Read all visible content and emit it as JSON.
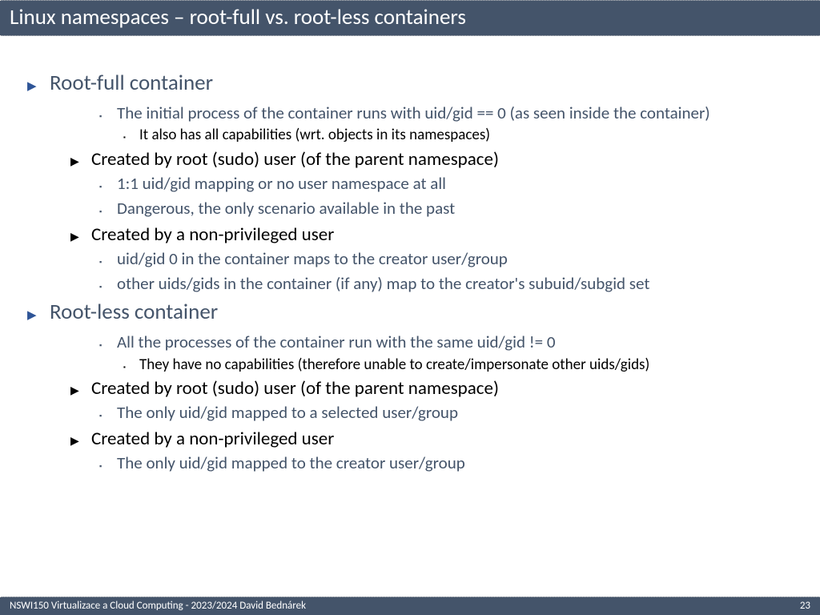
{
  "title": "Linux namespaces – root-full vs. root-less containers",
  "sections": [
    {
      "heading": "Root-full container",
      "items": [
        {
          "text": "The initial process of the container runs with uid/gid == 0 (as seen inside the container)",
          "style": "sub",
          "sub": [
            {
              "text": "It also has all capabilities (wrt. objects in its namespaces)"
            }
          ]
        },
        {
          "text": "Created by root (sudo) user (of the parent namespace)",
          "style": "black",
          "sub": [
            {
              "text": "1:1 uid/gid mapping or no user namespace at all"
            },
            {
              "text": "Dangerous, the only scenario available in the past"
            }
          ]
        },
        {
          "text": "Created by a non-privileged user",
          "style": "black",
          "sub": [
            {
              "text": "uid/gid 0 in the container maps to the creator user/group"
            },
            {
              "text": "other uids/gids in the container (if any) map to the creator's subuid/subgid set"
            }
          ]
        }
      ]
    },
    {
      "heading": "Root-less container",
      "items": [
        {
          "text": "All the processes of the container run with the same uid/gid != 0",
          "style": "sub",
          "sub": [
            {
              "text": "They have no capabilities (therefore unable to create/impersonate other uids/gids)"
            }
          ]
        },
        {
          "text": "Created by root (sudo) user (of the parent namespace)",
          "style": "black",
          "sub": [
            {
              "text": "The only uid/gid mapped to a selected user/group"
            }
          ]
        },
        {
          "text": "Created by a non-privileged user",
          "style": "black",
          "sub": [
            {
              "text": "The only uid/gid mapped to the creator user/group"
            }
          ]
        }
      ]
    }
  ],
  "footer": {
    "left": "NSWI150 Virtualizace a Cloud Computing - 2023/2024 David Bednárek",
    "page": "23"
  }
}
